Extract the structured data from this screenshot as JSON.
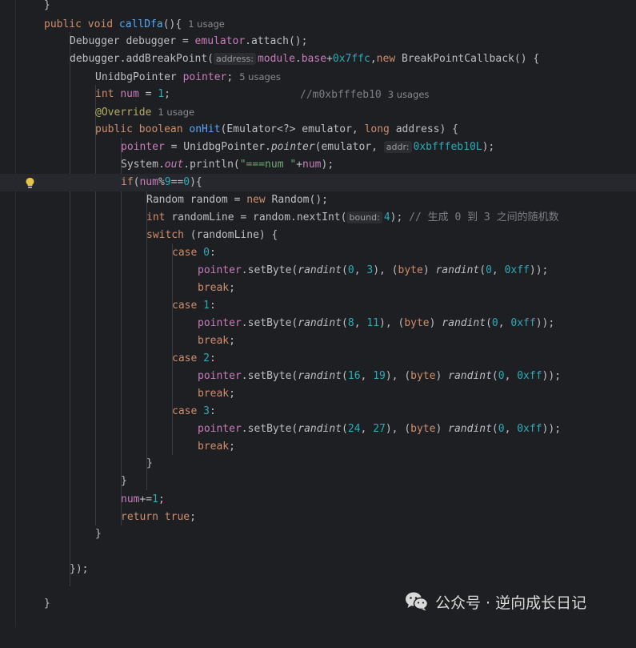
{
  "usage_hints": {
    "callDfa": "1 usage",
    "pointer": "5 usages",
    "num": "3 usages",
    "override": "1 usage"
  },
  "param_hints": {
    "address": "address:",
    "addr": "addr:",
    "bound": "bound:"
  },
  "comments": {
    "num_comment": "//m0xbfffeb10",
    "random_comment": "// 生成 0 到 3 之间的随机数"
  },
  "strings": {
    "println_text": "\"===num \""
  },
  "icons": {
    "bulb": "intention-bulb-icon",
    "wechat": "wechat-logo-icon"
  },
  "watermark": {
    "text": "公众号 · 逆向成长日记"
  }
}
